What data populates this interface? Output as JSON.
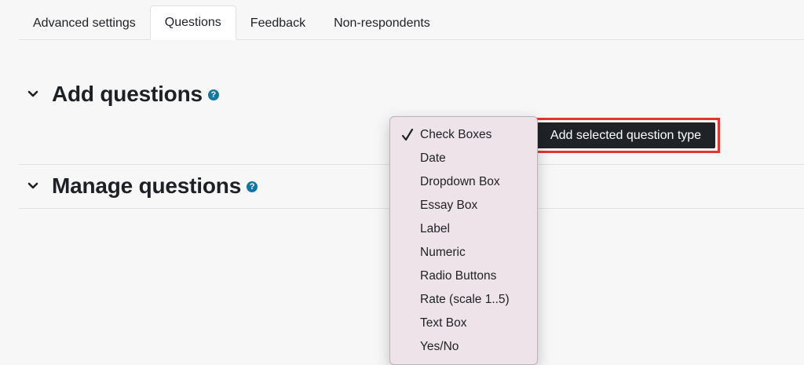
{
  "tabs": [
    {
      "label": "Advanced settings",
      "active": false
    },
    {
      "label": "Questions",
      "active": true
    },
    {
      "label": "Feedback",
      "active": false
    },
    {
      "label": "Non-respondents",
      "active": false
    }
  ],
  "add_questions": {
    "title": "Add questions",
    "help_icon": "question-circle-icon",
    "add_button_label": "Add selected question type",
    "selected_option": "Check Boxes",
    "options": [
      "Check Boxes",
      "Date",
      "Dropdown Box",
      "Essay Box",
      "Label",
      "Numeric",
      "Radio Buttons",
      "Rate (scale 1..5)",
      "Text Box",
      "Yes/No"
    ]
  },
  "manage_questions": {
    "title": "Manage questions",
    "help_icon": "question-circle-icon"
  },
  "colors": {
    "highlight_border": "#e4352d",
    "button_bg": "#1f2327",
    "help_icon": "#1177a3",
    "dropdown_bg": "#ede3e8"
  }
}
